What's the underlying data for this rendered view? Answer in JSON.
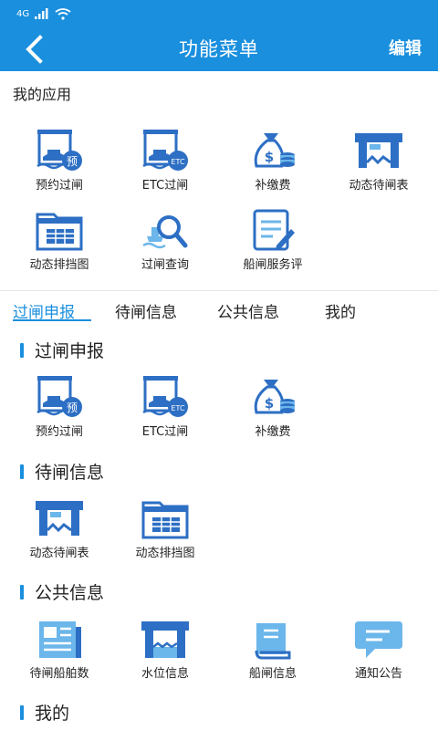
{
  "status": {
    "network": "4G"
  },
  "header": {
    "title": "功能菜单",
    "edit": "编辑"
  },
  "my_apps": {
    "title": "我的应用",
    "items": [
      "预约过闸",
      "ETC过闸",
      "补缴费",
      "动态待闸表",
      "动态排挡图",
      "过闸查询",
      "船闸服务评"
    ]
  },
  "tabs": [
    "过闸申报",
    "待闸信息",
    "公共信息",
    "我的"
  ],
  "categories": {
    "declare": {
      "title": "过闸申报",
      "items": [
        "预约过闸",
        "ETC过闸",
        "补缴费"
      ]
    },
    "waiting": {
      "title": "待闸信息",
      "items": [
        "动态待闸表",
        "动态排挡图"
      ]
    },
    "public": {
      "title": "公共信息",
      "items": [
        "待闸船舶数",
        "水位信息",
        "船闸信息",
        "通知公告"
      ]
    },
    "mine": {
      "title": "我的"
    }
  },
  "badges": {
    "reserve": "预",
    "etc": "ETC",
    "money": "$"
  },
  "colors": {
    "primary": "#1a8fde",
    "icon": "#2d6fc4",
    "icon_light": "#6bb6ea"
  }
}
